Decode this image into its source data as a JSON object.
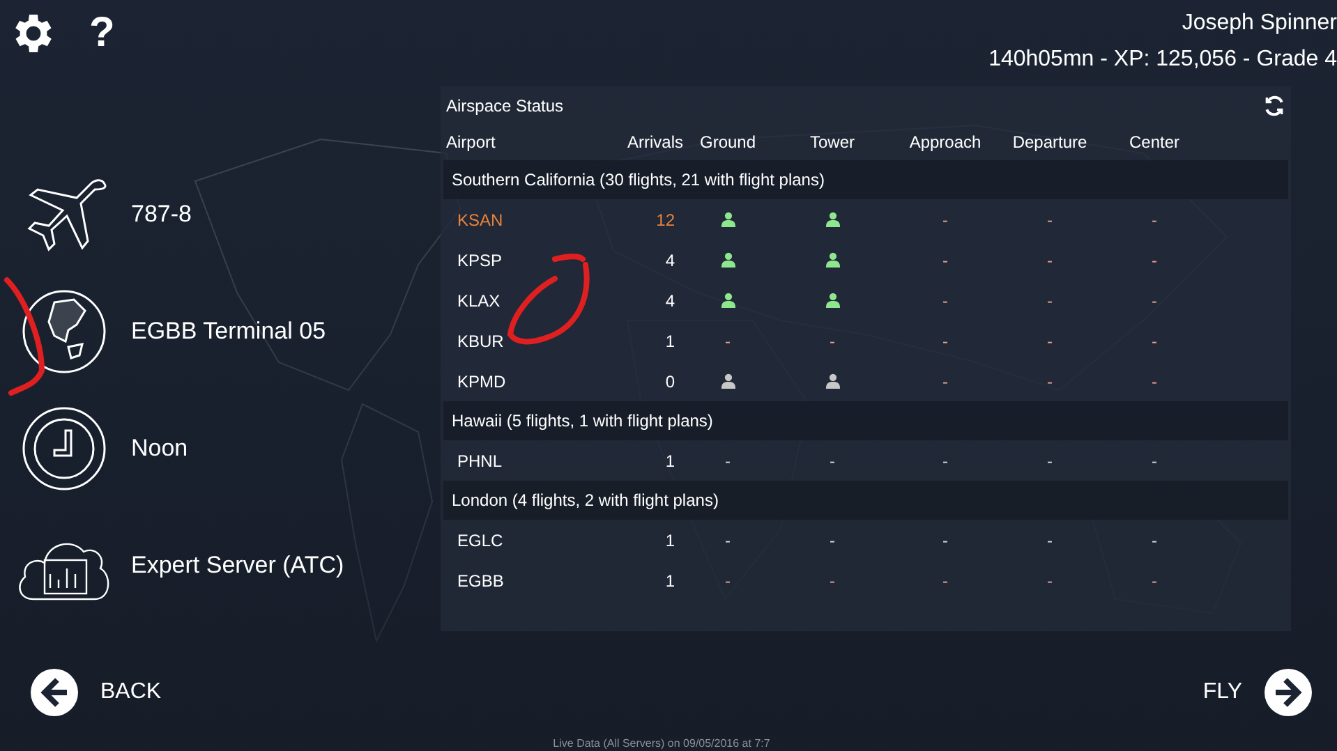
{
  "top_bar": {
    "help": "?",
    "user_name": "Joseph Spinner",
    "stats": "140h05mn - XP: 125,056 - Grade 4"
  },
  "menu": [
    {
      "kind": "aircraft",
      "label": "787-8"
    },
    {
      "kind": "location",
      "label": "EGBB Terminal 05"
    },
    {
      "kind": "time",
      "label": "Noon"
    },
    {
      "kind": "server",
      "label": "Expert Server (ATC)"
    }
  ],
  "airspace": {
    "title": "Airspace Status",
    "columns": [
      "Airport",
      "Arrivals",
      "Ground",
      "Tower",
      "Approach",
      "Departure",
      "Center"
    ],
    "groups": [
      {
        "title": "Southern California (30 flights, 21 with flight plans)",
        "rows": [
          {
            "airport": "KSAN",
            "highlighted": true,
            "arrivals": "12",
            "cells": [
              {
                "kind": "controller",
                "color": "#8ee68e"
              },
              {
                "kind": "controller",
                "color": "#8ee68e"
              },
              {
                "kind": "dash",
                "text": "-",
                "color": "#e8a090"
              },
              {
                "kind": "dash",
                "text": "-",
                "color": "#e8a090"
              },
              {
                "kind": "dash",
                "text": "-",
                "color": "#e8a090"
              }
            ]
          },
          {
            "airport": "KPSP",
            "highlighted": false,
            "arrivals": "4",
            "cells": [
              {
                "kind": "controller",
                "color": "#8ee68e"
              },
              {
                "kind": "controller",
                "color": "#8ee68e"
              },
              {
                "kind": "dash",
                "text": "-",
                "color": "#e8a090"
              },
              {
                "kind": "dash",
                "text": "-",
                "color": "#e8a090"
              },
              {
                "kind": "dash",
                "text": "-",
                "color": "#e8a090"
              }
            ]
          },
          {
            "airport": "KLAX",
            "highlighted": false,
            "arrivals": "4",
            "cells": [
              {
                "kind": "controller",
                "color": "#8ee68e"
              },
              {
                "kind": "controller",
                "color": "#8ee68e"
              },
              {
                "kind": "dash",
                "text": "-",
                "color": "#e8a090"
              },
              {
                "kind": "dash",
                "text": "-",
                "color": "#e8a090"
              },
              {
                "kind": "dash",
                "text": "-",
                "color": "#e8a090"
              }
            ]
          },
          {
            "airport": "KBUR",
            "highlighted": false,
            "arrivals": "1",
            "cells": [
              {
                "kind": "dash",
                "text": "-",
                "color": "#e8a090"
              },
              {
                "kind": "dash",
                "text": "-",
                "color": "#e8a090"
              },
              {
                "kind": "dash",
                "text": "-",
                "color": "#e8a090"
              },
              {
                "kind": "dash",
                "text": "-",
                "color": "#e8a090"
              },
              {
                "kind": "dash",
                "text": "-",
                "color": "#e8a090"
              }
            ]
          },
          {
            "airport": "KPMD",
            "highlighted": false,
            "arrivals": "0",
            "cells": [
              {
                "kind": "controller",
                "color": "#c8c8c8"
              },
              {
                "kind": "controller",
                "color": "#c8c8c8"
              },
              {
                "kind": "dash",
                "text": "-",
                "color": "#e8a090"
              },
              {
                "kind": "dash",
                "text": "-",
                "color": "#e8a090"
              },
              {
                "kind": "dash",
                "text": "-",
                "color": "#e8a090"
              }
            ]
          }
        ]
      },
      {
        "title": "Hawaii (5 flights, 1 with flight plans)",
        "rows": [
          {
            "airport": "PHNL",
            "highlighted": false,
            "arrivals": "1",
            "cells": [
              {
                "kind": "dash",
                "text": "-",
                "color": "#d8d8d8"
              },
              {
                "kind": "dash",
                "text": "-",
                "color": "#d8d8d8"
              },
              {
                "kind": "dash",
                "text": "-",
                "color": "#d8d8d8"
              },
              {
                "kind": "dash",
                "text": "-",
                "color": "#d8d8d8"
              },
              {
                "kind": "dash",
                "text": "-",
                "color": "#d8d8d8"
              }
            ]
          }
        ]
      },
      {
        "title": "London (4 flights, 2 with flight plans)",
        "rows": [
          {
            "airport": "EGLC",
            "highlighted": false,
            "arrivals": "1",
            "cells": [
              {
                "kind": "dash",
                "text": "-",
                "color": "#d8d8d8"
              },
              {
                "kind": "dash",
                "text": "-",
                "color": "#d8d8d8"
              },
              {
                "kind": "dash",
                "text": "-",
                "color": "#d8d8d8"
              },
              {
                "kind": "dash",
                "text": "-",
                "color": "#d8d8d8"
              },
              {
                "kind": "dash",
                "text": "-",
                "color": "#d8d8d8"
              }
            ]
          },
          {
            "airport": "EGBB",
            "highlighted": false,
            "arrivals": "1",
            "cells": [
              {
                "kind": "dash",
                "text": "-",
                "color": "#e8a090"
              },
              {
                "kind": "dash",
                "text": "-",
                "color": "#e8a090"
              },
              {
                "kind": "dash",
                "text": "-",
                "color": "#e8a090"
              },
              {
                "kind": "dash",
                "text": "-",
                "color": "#e8a090"
              },
              {
                "kind": "dash",
                "text": "-",
                "color": "#e8a090"
              }
            ]
          }
        ]
      }
    ]
  },
  "footer": {
    "back": "BACK",
    "fly": "FLY",
    "status": "Live Data (All Servers) on 09/05/2016 at 7:7"
  }
}
